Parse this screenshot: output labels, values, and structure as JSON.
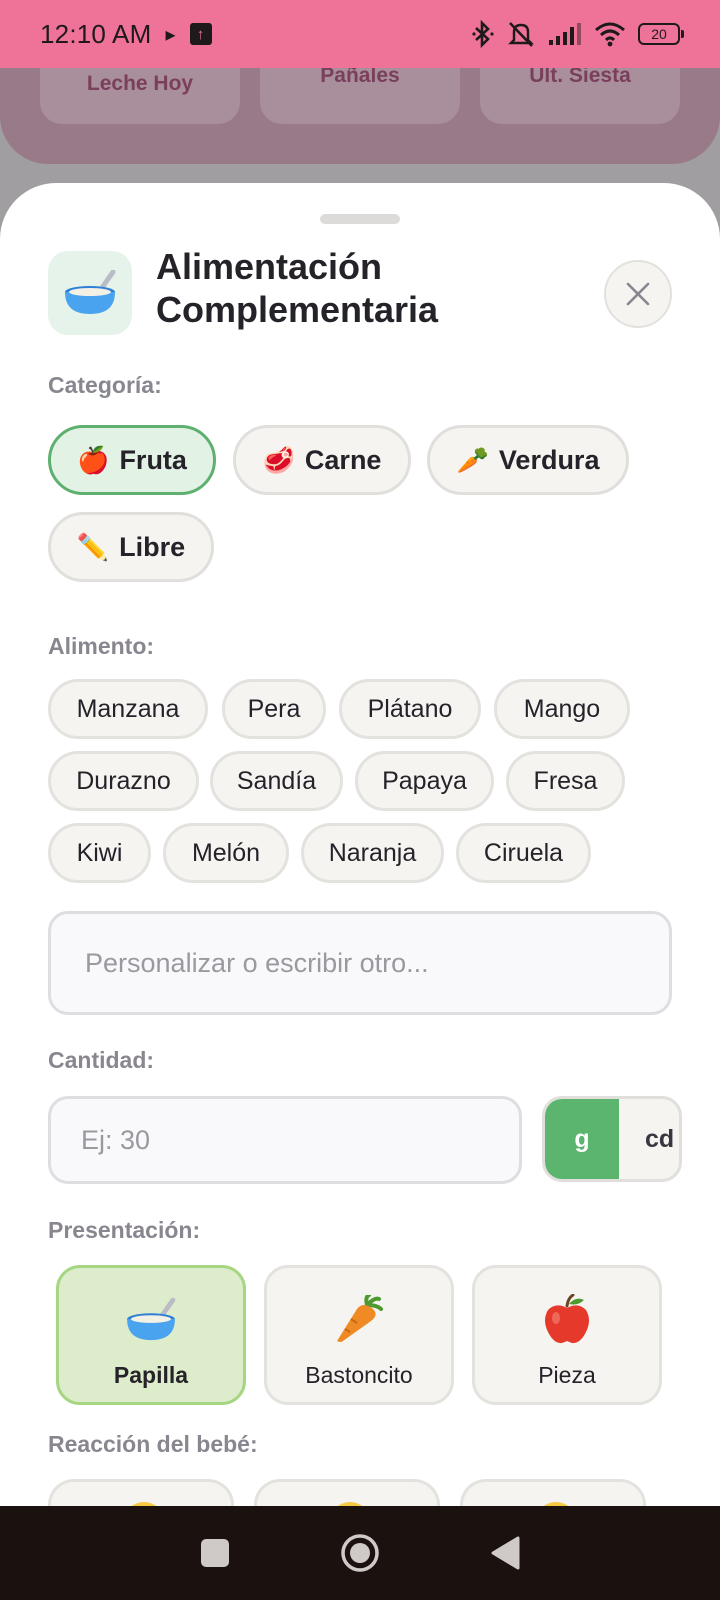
{
  "status_bar": {
    "time": "12:10 AM",
    "battery": "20",
    "icons": [
      "play-icon",
      "upload-icon",
      "bluetooth-icon",
      "mute-icon",
      "signal-icon",
      "wifi-icon",
      "battery-icon"
    ]
  },
  "background": {
    "stats": [
      "Leche Hoy",
      "Pañales",
      "Ult. Siesta"
    ]
  },
  "sheet": {
    "icon": "bowl-icon",
    "title": "Alimentación Complementaria",
    "category_label": "Categoría:",
    "categories": [
      {
        "emoji": "🍎",
        "label": "Fruta",
        "selected": true
      },
      {
        "emoji": "🥩",
        "label": "Carne",
        "selected": false
      },
      {
        "emoji": "🥕",
        "label": "Verdura",
        "selected": false
      },
      {
        "emoji": "✏️",
        "label": "Libre",
        "selected": false
      }
    ],
    "food_label": "Alimento:",
    "foods": [
      "Manzana",
      "Pera",
      "Plátano",
      "Mango",
      "Durazno",
      "Sandía",
      "Papaya",
      "Fresa",
      "Kiwi",
      "Melón",
      "Naranja",
      "Ciruela"
    ],
    "custom_placeholder": "Personalizar o escribir otro...",
    "quantity_label": "Cantidad:",
    "quantity_placeholder": "Ej: 30",
    "units": [
      "g",
      "cd"
    ],
    "active_unit": "g",
    "presentation_label": "Presentación:",
    "presentations": [
      {
        "icon": "bowl-icon",
        "label": "Papilla",
        "selected": true
      },
      {
        "icon": "carrot-icon",
        "label": "Bastoncito",
        "selected": false
      },
      {
        "icon": "apple-icon",
        "label": "Pieza",
        "selected": false
      }
    ],
    "reaction_label": "Reacción del bebé:"
  },
  "colors": {
    "status_bar": "#ef7298",
    "accent_green": "#5cb56e",
    "selected_chip_bg": "#e2f3e6",
    "selected_card_bg": "#ddedcb",
    "nav_bar": "#1b120f"
  }
}
